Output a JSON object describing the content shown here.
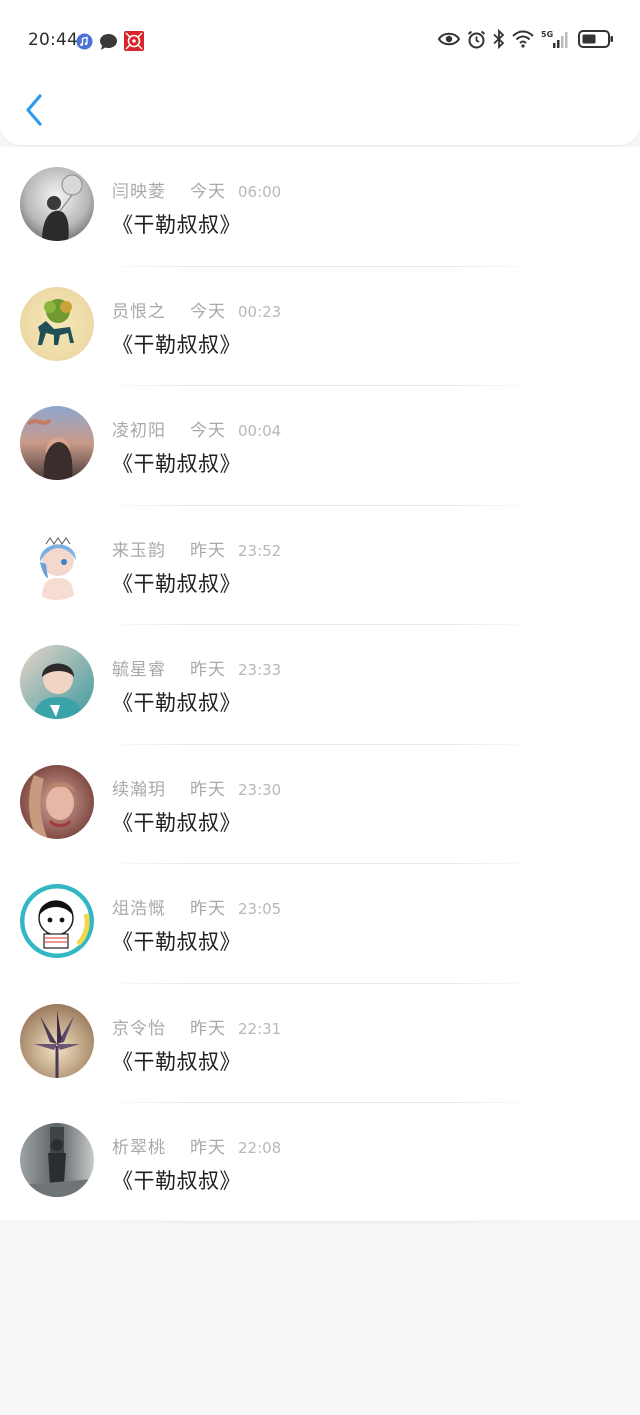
{
  "status_bar": {
    "time": "20:44",
    "network": "5G",
    "left_icons": [
      "music-icon",
      "chat-bubble-icon",
      "app-icon"
    ],
    "right_icons": [
      "eye-icon",
      "alarm-icon",
      "bluetooth-icon",
      "wifi-icon",
      "signal-icon",
      "battery-icon"
    ]
  },
  "header": {
    "back_icon": "chevron-left-icon",
    "accent": "#2d9bf0"
  },
  "comments": [
    {
      "name": "闫映菱",
      "day": "今天",
      "time": "06:00",
      "text": "《干勒叔叔》"
    },
    {
      "name": "员恨之",
      "day": "今天",
      "time": "00:23",
      "text": "《干勒叔叔》"
    },
    {
      "name": "凌初阳",
      "day": "今天",
      "time": "00:04",
      "text": "《干勒叔叔》"
    },
    {
      "name": "来玉韵",
      "day": "昨天",
      "time": "23:52",
      "text": "《干勒叔叔》"
    },
    {
      "name": "毓星睿",
      "day": "昨天",
      "time": "23:33",
      "text": "《干勒叔叔》"
    },
    {
      "name": "续瀚玥",
      "day": "昨天",
      "time": "23:30",
      "text": "《干勒叔叔》"
    },
    {
      "name": "俎浩慨",
      "day": "昨天",
      "time": "23:05",
      "text": "《干勒叔叔》"
    },
    {
      "name": "京令怡",
      "day": "昨天",
      "time": "22:31",
      "text": "《干勒叔叔》"
    },
    {
      "name": "析翠桃",
      "day": "昨天",
      "time": "22:08",
      "text": "《干勒叔叔》"
    }
  ]
}
